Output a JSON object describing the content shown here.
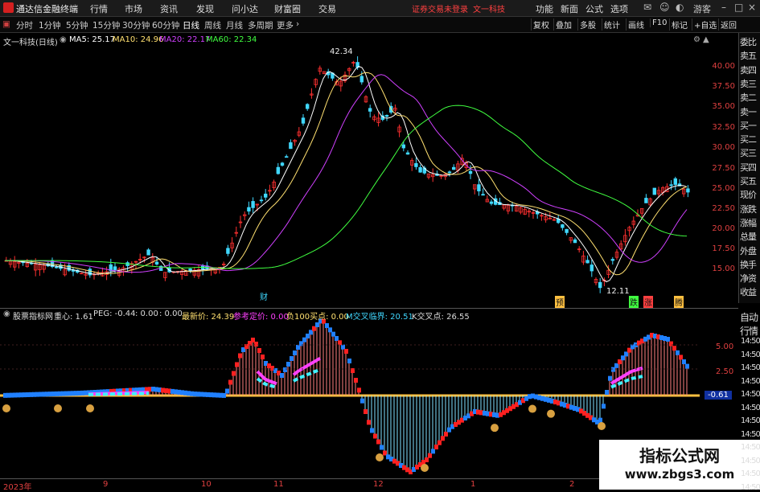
{
  "app": {
    "title": "通达信金融终端"
  },
  "menu": [
    "行情",
    "市场",
    "资讯",
    "发现",
    "问小达",
    "财富圈",
    "交易"
  ],
  "login_notice": "证券交易未登录",
  "stock_name_top": "文一科技",
  "top_right": [
    "功能",
    "新面",
    "公式",
    "选项"
  ],
  "guest": "游客",
  "periods": [
    "分时",
    "1分钟",
    "5分钟",
    "15分钟",
    "30分钟",
    "60分钟",
    "日线",
    "周线",
    "月线",
    "多周期",
    "更多"
  ],
  "active_period": "日线",
  "toolbar_right": [
    "复权",
    "叠加",
    "多股",
    "统计",
    "画线",
    "F10",
    "标记",
    "+自选",
    "返回"
  ],
  "legend": {
    "stock": "文一科技(日线)",
    "ma5": "MA5: 25.17",
    "ma10": "MA10: 24.96",
    "ma20": "MA20: 22.17",
    "ma60": "MA60: 22.34"
  },
  "price_axis": [
    "40.00",
    "37.50",
    "35.00",
    "32.50",
    "30.00",
    "27.50",
    "25.00",
    "22.50",
    "20.00",
    "17.50",
    "15.00"
  ],
  "annotations": {
    "high": "42.34",
    "low": "12.11",
    "cai": "财",
    "yu": "预",
    "die": "跌",
    "zhang": "涨",
    "teng": "腾"
  },
  "right_panel": [
    "委比",
    "卖五",
    "卖四",
    "卖三",
    "卖二",
    "卖一",
    "买一",
    "买二",
    "买三",
    "买四",
    "买五",
    "现价",
    "涨跌",
    "涨幅",
    "总量",
    "外盘",
    "换手",
    "净资",
    "收益"
  ],
  "right_panel2": [
    "自动",
    "行情",
    "14:50",
    "14:50",
    "14:50",
    "14:50",
    "14:50",
    "14:50",
    "14:50",
    "14:50",
    "14:50",
    "14:50",
    "14:50",
    "14:50"
  ],
  "lower_legend": {
    "name": "股票指标网",
    "zx": "重心: 1.61",
    "peg": "PEG: -0.44",
    "z1": ": 0.00",
    "z2": ": 0.00",
    "latest": "最新价: 24.39",
    "ref": "参考定价: 0.00",
    "neg100": "负100买点: 0.00",
    "mcross": "M交叉临界: 20.51",
    "kcross": "K交叉点: 26.55"
  },
  "lower_axis": [
    "5.00",
    "2.50",
    "-0.61"
  ],
  "time_axis": [
    "2023年",
    "9",
    "10",
    "11",
    "12",
    "1",
    "2"
  ],
  "watermark": {
    "title": "指标公式网",
    "url": "www.zbgs3.com"
  },
  "colors": {
    "up": "#ff3030",
    "down": "#40d8ff",
    "ma5": "#ffffff",
    "ma10": "#ffe070",
    "ma20": "#d040ff",
    "ma60": "#40ff40"
  }
}
